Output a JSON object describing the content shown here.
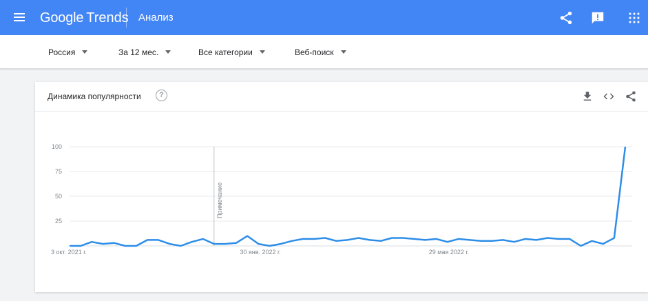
{
  "header": {
    "logo_google": "Google",
    "logo_trends": "Trends",
    "page_title": "Анализ",
    "icons": [
      "menu-icon",
      "share-icon",
      "feedback-icon",
      "apps-grid-icon"
    ],
    "color": "#4285f4"
  },
  "filters": [
    {
      "label": "Россия"
    },
    {
      "label": "За 12 мес."
    },
    {
      "label": "Все категории"
    },
    {
      "label": "Веб-поиск"
    }
  ],
  "card": {
    "title": "Динамика популярности",
    "help": "?",
    "icons": [
      "download-icon",
      "embed-code-icon",
      "share-icon"
    ]
  },
  "chart_data": {
    "type": "line",
    "title": "",
    "xlabel": "",
    "ylabel": "",
    "ylim": [
      0,
      100
    ],
    "yticks": [
      "100",
      "75",
      "50",
      "25"
    ],
    "xtick_labels": [
      {
        "label": "3 окт. 2021 г.",
        "index": 0
      },
      {
        "label": "30 янв. 2022 г.",
        "index": 17
      },
      {
        "label": "29 мая 2022 г.",
        "index": 34
      }
    ],
    "annotation": {
      "label": "Примечание",
      "index": 13
    },
    "line_color": "#2d8de8",
    "series": [
      {
        "values": [
          0,
          0,
          4,
          2,
          3,
          0,
          0,
          6,
          6,
          2,
          0,
          4,
          7,
          2,
          2,
          3,
          10,
          2,
          0,
          2,
          5,
          7,
          7,
          8,
          5,
          6,
          8,
          6,
          5,
          8,
          8,
          7,
          6,
          7,
          4,
          7,
          6,
          5,
          5,
          6,
          4,
          7,
          6,
          8,
          7,
          7,
          0,
          5,
          2,
          8,
          100
        ]
      }
    ]
  }
}
